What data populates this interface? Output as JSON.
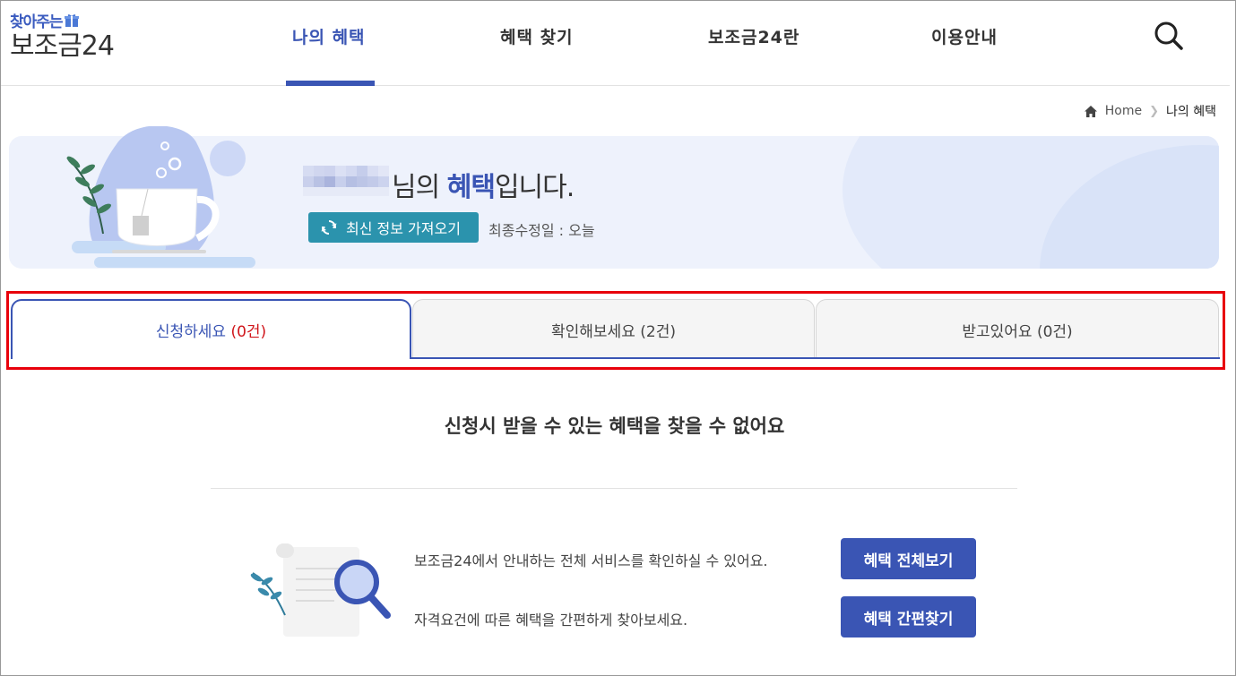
{
  "brand": {
    "tagline": "찾아주는",
    "name": "보조금24"
  },
  "nav": {
    "items": [
      {
        "label": "나의 혜택",
        "active": true
      },
      {
        "label": "혜택 찾기",
        "active": false
      },
      {
        "label": "보조금24란",
        "active": false
      },
      {
        "label": "이용안내",
        "active": false
      }
    ],
    "search_icon": "search-icon"
  },
  "breadcrumb": {
    "home": "Home",
    "current": "나의 혜택"
  },
  "banner": {
    "greeting_suffix_1": "님의 ",
    "greeting_bold": "혜택",
    "greeting_suffix_2": "입니다.",
    "refresh_label": "최신 정보 가져오기",
    "updated_text": "최종수정일 : 오늘"
  },
  "tabs": [
    {
      "label": "신청하세요",
      "count": "(0건)"
    },
    {
      "label": "확인해보세요",
      "count": "(2건)"
    },
    {
      "label": "받고있어요",
      "count": "(0건)"
    }
  ],
  "empty_state": {
    "title": "신청시 받을 수 있는 혜택을 찾을 수 없어요",
    "line1": "보조금24에서 안내하는 전체 서비스를 확인하실 수 있어요.",
    "line2": "자격요건에 따른 혜택을 간편하게 찾아보세요.",
    "button1": "혜택 전체보기",
    "button2": "혜택 간편찾기"
  },
  "colors": {
    "primary": "#3a55b4",
    "teal": "#2b93ad",
    "highlight": "#e8000b",
    "count_red": "#d0161b"
  }
}
